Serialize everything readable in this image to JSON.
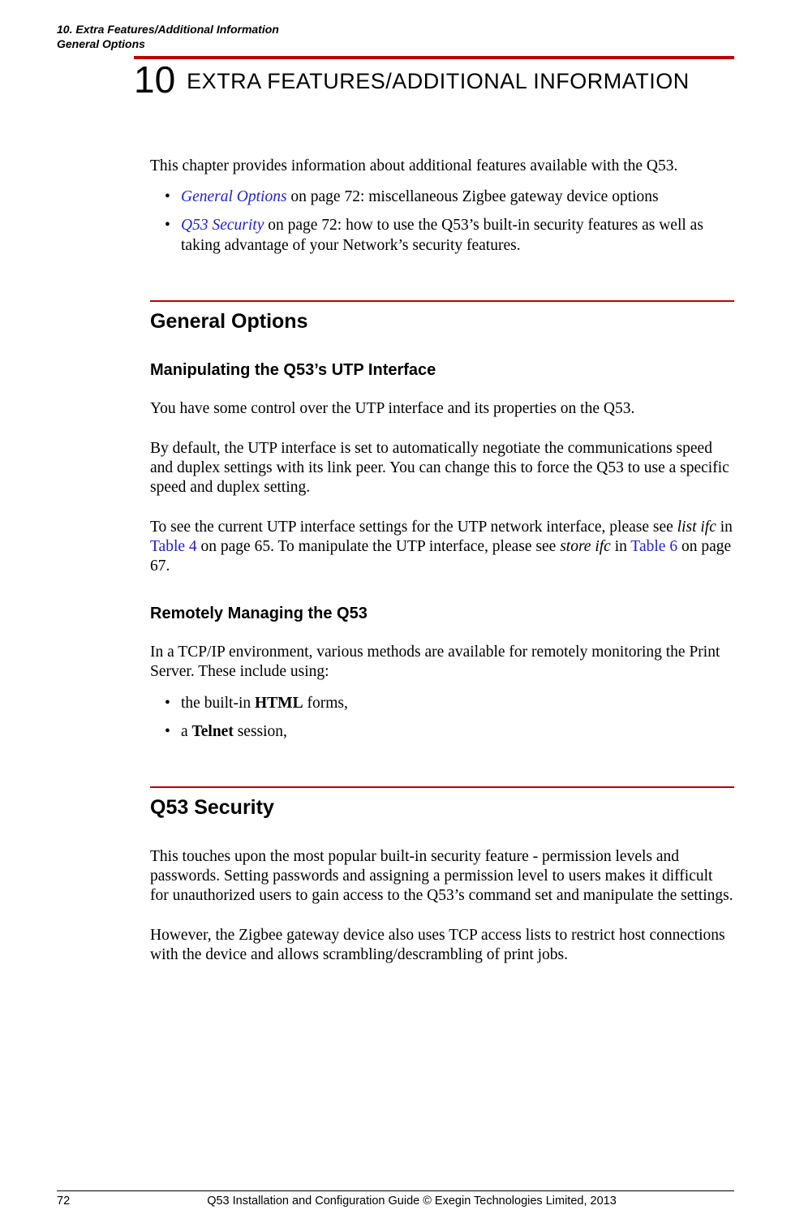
{
  "running_head": {
    "line1": "10. Extra Features/Additional Information",
    "line2": "General Options"
  },
  "chapter": {
    "number": "10",
    "title_html": "E<span style='font-size:22px'>XTRA</span> F<span style='font-size:22px'>EATURES</span>/A<span style='font-size:22px'>DDITIONAL</span> I<span style='font-size:22px'>NFORMATION</span>"
  },
  "intro": "This chapter provides information about additional features available with the Q53.",
  "toc": [
    {
      "link": "General Options",
      "rest": " on page 72: miscellaneous Zigbee gateway device options"
    },
    {
      "link": "Q53 Security",
      "rest": " on page 72: how to use the Q53’s built-in security features as well as taking advantage of your Network’s security features."
    }
  ],
  "sec_general": {
    "title": "General Options",
    "sub1": {
      "title": "Manipulating the Q53’s UTP Interface",
      "p1": "You have some control over the UTP interface and its properties on the Q53.",
      "p2": "By default, the UTP interface is set to automatically negotiate the communications speed and duplex settings with its link peer. You can change this to force the Q53 to use a specific speed and duplex setting.",
      "p3_pre": "To see the current UTP interface settings for the UTP network interface, please see ",
      "p3_cmd1": "list ifc",
      "p3_mid1": " in ",
      "p3_link1": "Table 4",
      "p3_mid2": " on page 65. To manipulate the UTP interface, please see ",
      "p3_cmd2": "store ifc",
      "p3_mid3": " in ",
      "p3_link2": "Table 6",
      "p3_post": " on page 67."
    },
    "sub2": {
      "title": "Remotely Managing the Q53",
      "p1": "In a TCP/IP environment, various methods are available for remotely monitoring the Print Server. These include using:",
      "b1_pre": "the built-in ",
      "b1_bold": "HTML",
      "b1_post": " forms,",
      "b2_pre": "a ",
      "b2_bold": "Telnet",
      "b2_post": " session,"
    }
  },
  "sec_security": {
    "title": "Q53 Security",
    "p1": "This touches upon the most popular built-in security feature - permission levels and passwords. Setting passwords and assigning a permission level to users makes it difficult for unauthorized users to gain access to the Q53’s command set and manipulate the settings.",
    "p2": "However, the Zigbee gateway device also uses TCP access lists to restrict host connections with the device and allows scrambling/descrambling of print jobs."
  },
  "footer": {
    "page": "72",
    "text": "Q53 Installation and Configuration Guide  © Exegin Technologies Limited, 2013"
  }
}
